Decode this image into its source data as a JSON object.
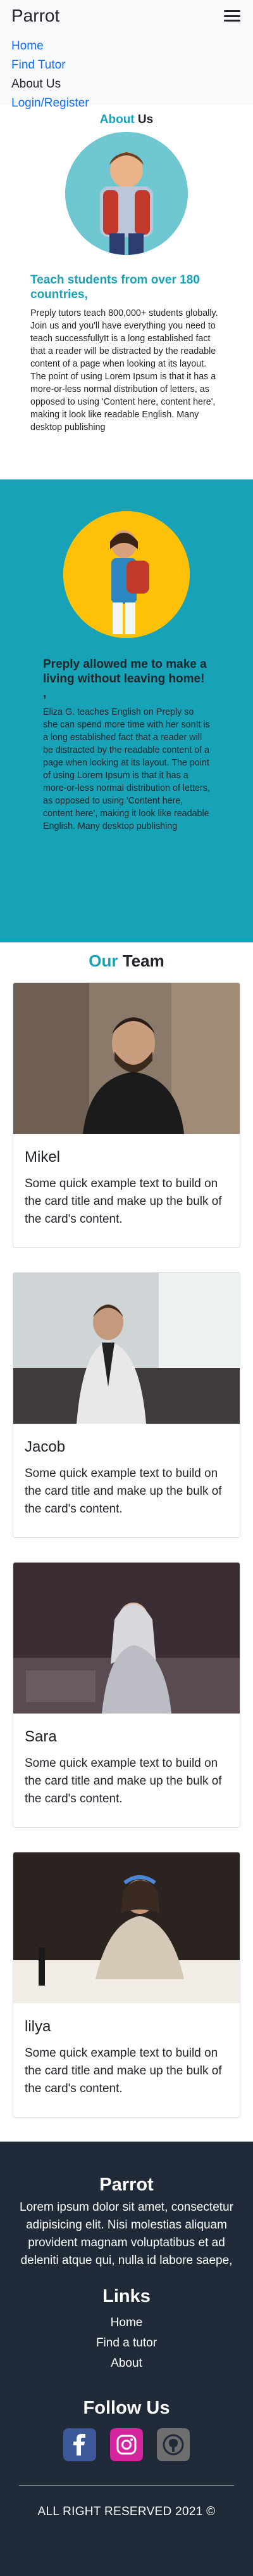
{
  "navbar": {
    "brand": "Parrot",
    "links": [
      {
        "label": "Home"
      },
      {
        "label": "Find Tutor"
      },
      {
        "label": "About Us"
      },
      {
        "label": "Login/Register"
      }
    ]
  },
  "about": {
    "title_hl": "About",
    "title_rest": " Us",
    "heading": "Teach students from over 180 countries,",
    "text": "Preply tutors teach 800,000+ students globally. Join us and you'll have everything you need to teach successfullyIt is a long established fact that a reader will be distracted by the readable content of a page when looking at its layout. The point of using Lorem Ipsum is that it has a more-or-less normal distribution of letters, as opposed to using 'Content here, content here', making it look like readable English. Many desktop publishing"
  },
  "testimonial": {
    "heading": "Preply allowed me to make a living without leaving home! ,",
    "text": "Eliza G. teaches English on Preply so she can spend more time with her sonIt is a long established fact that a reader will be distracted by the readable content of a page when looking at its layout. The point of using Lorem Ipsum is that it has a more-or-less normal distribution of letters, as opposed to using 'Content here, content here', making it look like readable English. Many desktop publishing"
  },
  "team": {
    "title_hl": "Our",
    "title_rest": " Team",
    "members": [
      {
        "name": "Mikel",
        "text": "Some quick example text to build on the card title and make up the bulk of the card's content."
      },
      {
        "name": "Jacob",
        "text": "Some quick example text to build on the card title and make up the bulk of the card's content."
      },
      {
        "name": "Sara",
        "text": "Some quick example text to build on the card title and make up the bulk of the card's content."
      },
      {
        "name": "lilya",
        "text": "Some quick example text to build on the card title and make up the bulk of the card's content."
      }
    ]
  },
  "footer": {
    "title": "Parrot",
    "text": "Lorem ipsum dolor sit amet, consectetur adipisicing elit. Nisi molestias aliquam provident magnam voluptatibus et ad deleniti atque qui, nulla id labore saepe,",
    "links_title": "Links",
    "links": [
      "Home",
      "Find a tutor",
      "About"
    ],
    "follow_title": "Follow Us",
    "copyright": "ALL RIGHT RESERVED 2021 ©"
  },
  "colors": {
    "accent": "#17a2b8",
    "link": "#0d6efd",
    "footer_bg": "#212a38",
    "yellow": "#ffc107"
  }
}
